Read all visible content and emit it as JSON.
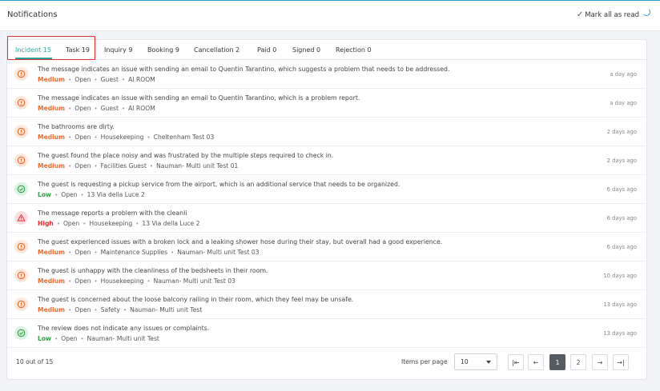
{
  "header": {
    "title": "Notifications",
    "mark_all_label": "Mark all as read"
  },
  "tabs": [
    {
      "label": "Incident 15",
      "active": true
    },
    {
      "label": "Task 19",
      "active": false
    },
    {
      "label": "Inquiry 9",
      "active": false
    },
    {
      "label": "Booking 9",
      "active": false
    },
    {
      "label": "Cancellation 2",
      "active": false
    },
    {
      "label": "Paid 0",
      "active": false
    },
    {
      "label": "Signed 0",
      "active": false
    },
    {
      "label": "Rejection 0",
      "active": false
    }
  ],
  "notifications": [
    {
      "message": "The message indicates an issue with sending an email to Quentin Tarantino, which suggests a problem that needs to be addressed.",
      "severity": "Medium",
      "status": "Open",
      "category": "Guest",
      "location": "AI ROOM",
      "time": "a day ago"
    },
    {
      "message": "The message indicates an issue with sending an email to Quentin Tarantino, which is a problem report.",
      "severity": "Medium",
      "status": "Open",
      "category": "Guest",
      "location": "AI ROOM",
      "time": "a day ago"
    },
    {
      "message": "The bathrooms are dirty.",
      "severity": "Medium",
      "status": "Open",
      "category": "Housekeeping",
      "location": "Cheltenham Test 03",
      "time": "2 days ago"
    },
    {
      "message": "The guest found the place noisy and was frustrated by the multiple steps required to check in.",
      "severity": "Medium",
      "status": "Open",
      "category": "Facilities Guest",
      "location": "Nauman- Multi unit Test 01",
      "time": "2 days ago"
    },
    {
      "message": "The guest is requesting a pickup service from the airport, which is an additional service that needs to be organized.",
      "severity": "Low",
      "status": "Open",
      "category": "",
      "location": "13 Via della Luce 2",
      "time": "6 days ago"
    },
    {
      "message": "The message reports a problem with the cleanli",
      "severity": "High",
      "status": "Open",
      "category": "Housekeeping",
      "location": "13 Via della Luce 2",
      "time": "6 days ago"
    },
    {
      "message": "The guest experienced issues with a broken lock and a leaking shower hose during their stay, but overall had a good experience.",
      "severity": "Medium",
      "status": "Open",
      "category": "Maintenance Supplies",
      "location": "Nauman- Multi unit Test 03",
      "time": "6 days ago"
    },
    {
      "message": "The guest is unhappy with the cleanliness of the bedsheets in their room.",
      "severity": "Medium",
      "status": "Open",
      "category": "Housekeeping",
      "location": "Nauman- Multi unit Test 03",
      "time": "10 days ago"
    },
    {
      "message": "The guest is concerned about the loose balcony railing in their room, which they feel may be unsafe.",
      "severity": "Medium",
      "status": "Open",
      "category": "Safety",
      "location": "Nauman- Multi unit Test",
      "time": "13 days ago"
    },
    {
      "message": "The review does not indicate any issues or complaints.",
      "severity": "Low",
      "status": "Open",
      "category": "",
      "location": "Nauman- Multi unit Test",
      "time": "13 days ago"
    }
  ],
  "footer": {
    "count_label": "10 out of 15",
    "items_per_page_label": "Items per page",
    "items_per_page_value": "10",
    "pages": [
      "1",
      "2"
    ],
    "current_page": "1",
    "first_icon": "first-page-icon",
    "prev_icon": "arrow-left-icon",
    "next_icon": "arrow-right-icon",
    "last_icon": "last-page-icon"
  },
  "colors": {
    "accent": "#2aa39a",
    "medium": "#ee6b2c",
    "low": "#2f9e44",
    "high": "#e03131",
    "highlight": "#e03131"
  }
}
